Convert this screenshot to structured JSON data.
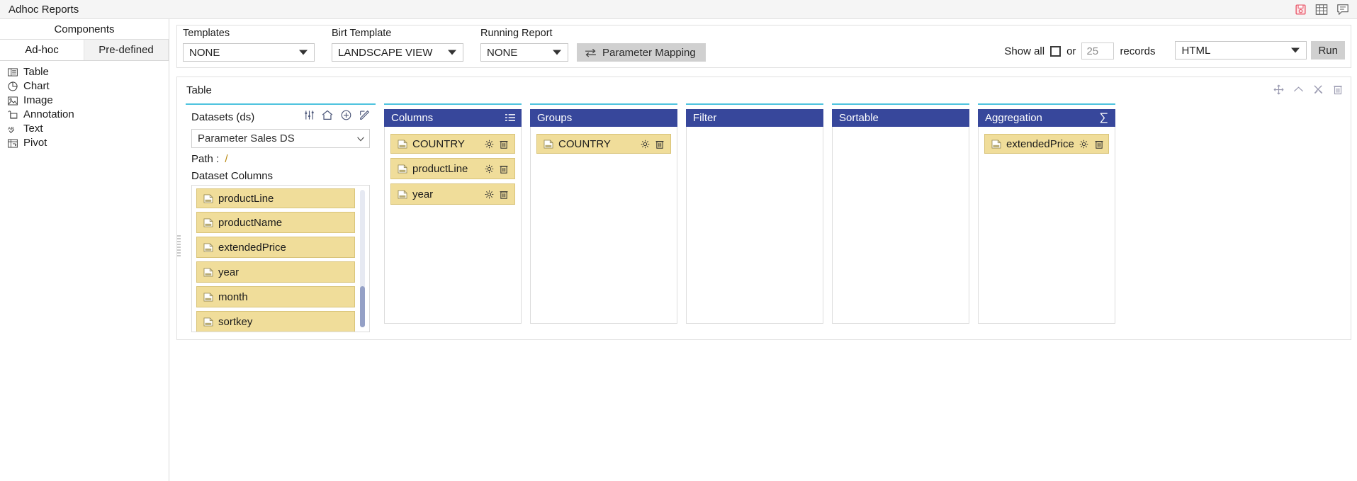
{
  "window": {
    "title": "Adhoc Reports",
    "title_icons": [
      "save-report-icon",
      "grid-table-icon",
      "comment-icon"
    ]
  },
  "sidebar": {
    "header": "Components",
    "tabs": [
      {
        "label": "Ad-hoc",
        "active": true
      },
      {
        "label": "Pre-defined",
        "active": false
      }
    ],
    "items": [
      {
        "label": "Table",
        "icon": "table-icon"
      },
      {
        "label": "Chart",
        "icon": "pie-chart-icon"
      },
      {
        "label": "Image",
        "icon": "image-icon"
      },
      {
        "label": "Annotation",
        "icon": "annotation-icon"
      },
      {
        "label": "Text",
        "icon": "text-ab-icon"
      },
      {
        "label": "Pivot",
        "icon": "pivot-table-icon"
      }
    ]
  },
  "toolbar": {
    "templates": {
      "label": "Templates",
      "value": "NONE"
    },
    "birt_template": {
      "label": "Birt Template",
      "value": "LANDSCAPE VIEW"
    },
    "running_report": {
      "label": "Running Report",
      "value": "NONE"
    },
    "parameter_mapping_button": "Parameter Mapping",
    "show_all_label": "Show all",
    "show_all_checked": false,
    "or_label": "or",
    "records_value": "25",
    "records_label": "records",
    "format": {
      "value": "HTML"
    },
    "run_button": "Run"
  },
  "report": {
    "title": "Table",
    "head_icons": [
      "move-icon",
      "collapse-chevron-icon",
      "tools-icon",
      "delete-icon"
    ],
    "datasets": {
      "title": "Datasets (ds)",
      "header_icons": [
        "sliders-icon",
        "home-icon",
        "plus-circle-icon",
        "edit-square-icon"
      ],
      "selected": "Parameter Sales DS",
      "path_label": "Path :",
      "path_value": "/",
      "columns_label": "Dataset Columns",
      "columns": [
        {
          "label": "productLine"
        },
        {
          "label": "productName"
        },
        {
          "label": "extendedPrice"
        },
        {
          "label": "year"
        },
        {
          "label": "month"
        },
        {
          "label": "sortkey"
        }
      ]
    },
    "panels": [
      {
        "title": "Columns",
        "header_icon": "list-lines-icon",
        "items": [
          {
            "label": "COUNTRY",
            "actions": [
              "gear-icon",
              "trash-icon"
            ]
          },
          {
            "label": "productLine",
            "actions": [
              "gear-icon",
              "trash-icon"
            ]
          },
          {
            "label": "year",
            "actions": [
              "gear-icon",
              "trash-icon"
            ]
          }
        ]
      },
      {
        "title": "Groups",
        "header_icon": "",
        "items": [
          {
            "label": "COUNTRY",
            "actions": [
              "gear-icon",
              "trash-icon"
            ]
          }
        ]
      },
      {
        "title": "Filter",
        "header_icon": "",
        "items": []
      },
      {
        "title": "Sortable",
        "header_icon": "",
        "items": []
      },
      {
        "title": "Aggregation",
        "header_icon": "sigma-icon",
        "items": [
          {
            "label": "extendedPrice",
            "actions": [
              "gear-icon",
              "trash-icon"
            ]
          }
        ]
      }
    ]
  },
  "colors": {
    "panel_header": "#37479b",
    "panel_top_accent": "#4ec3de",
    "chip_bg": "#f0dd9a",
    "chip_border": "#d9c47a",
    "button_bg": "#d0d0d0",
    "save_icon_red": "#e8596b"
  }
}
